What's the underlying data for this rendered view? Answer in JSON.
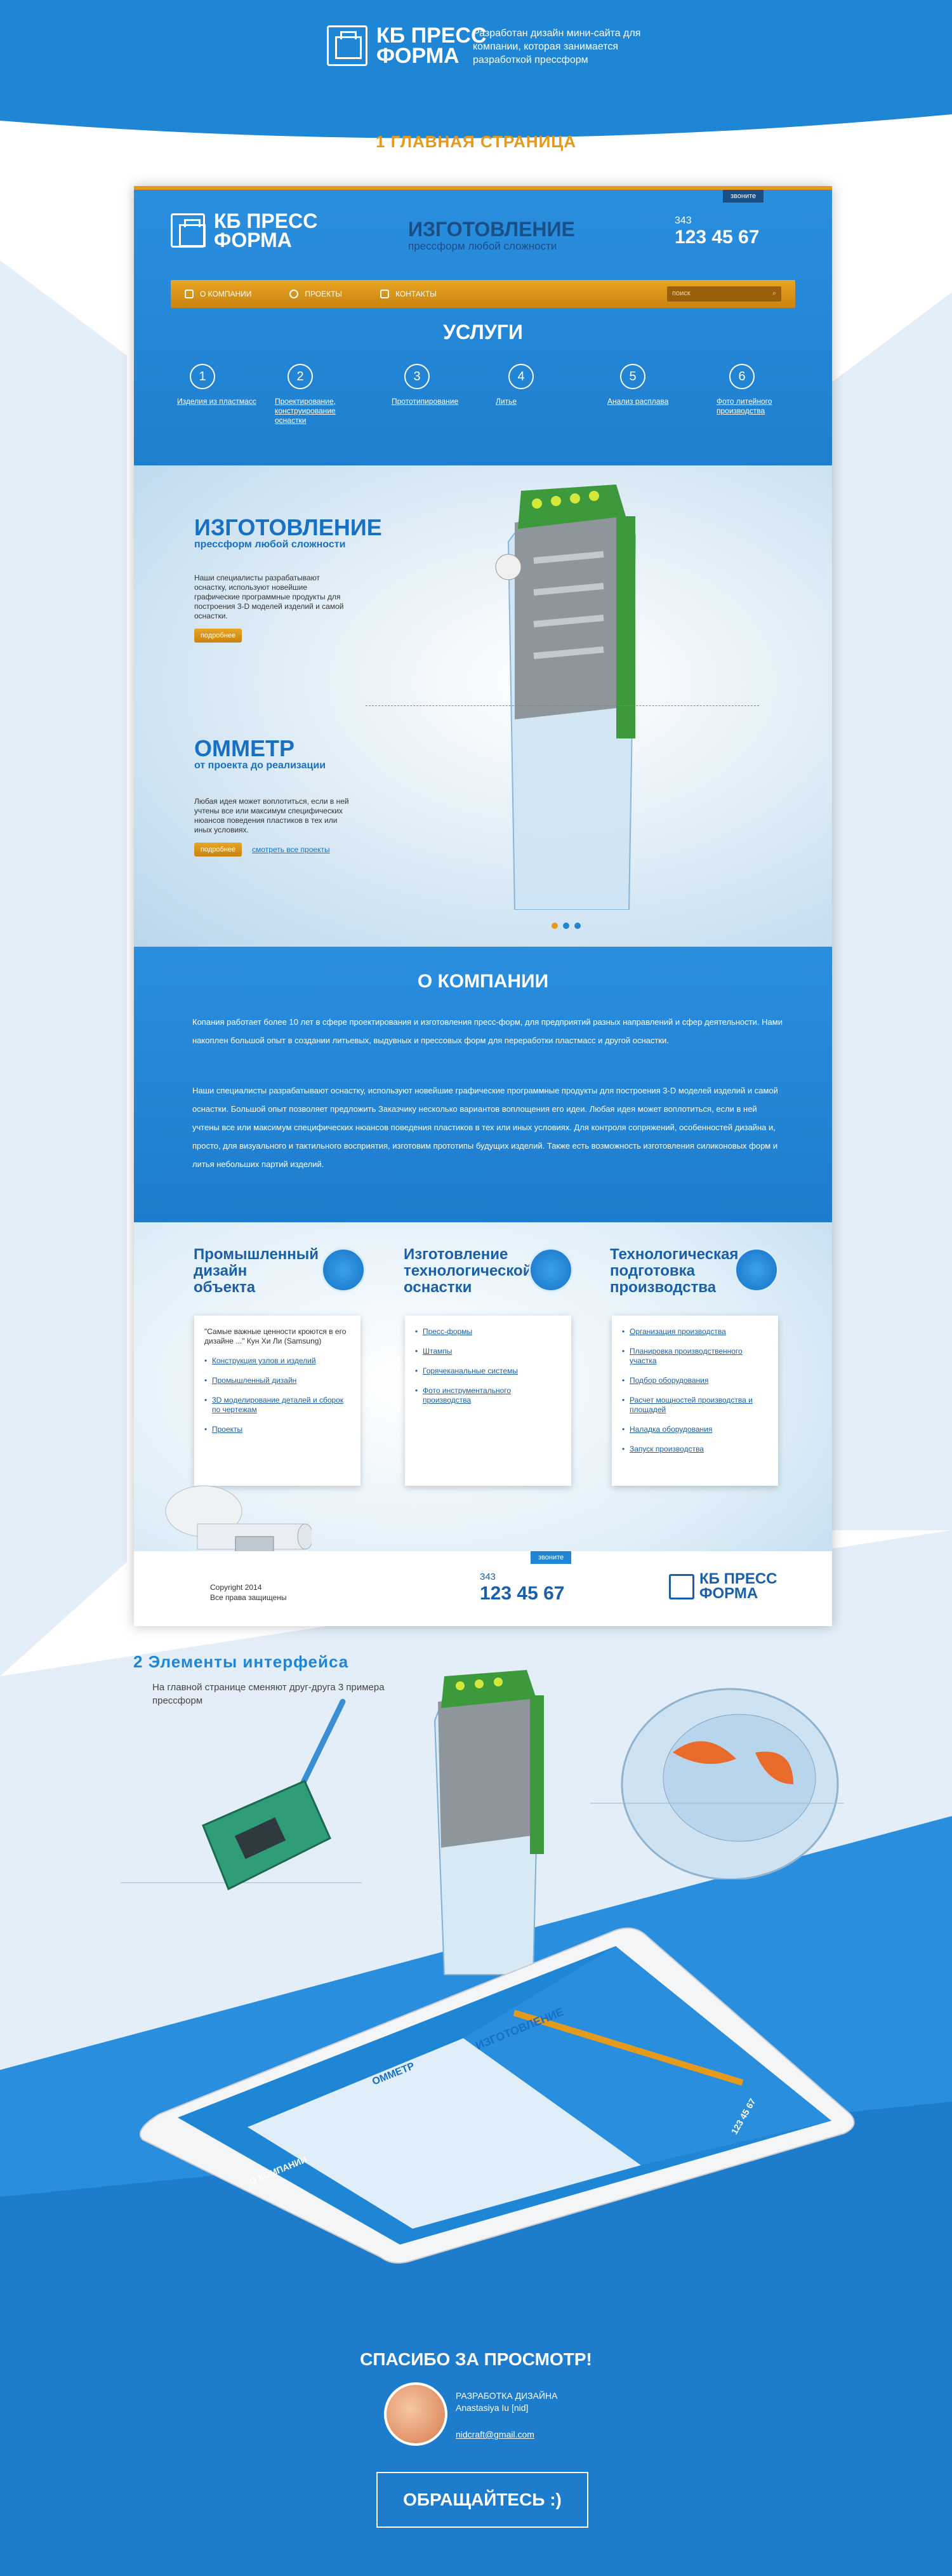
{
  "header": {
    "logo_line1": "КБ ПРЕСС",
    "logo_line2": "ФОРМА",
    "description": "Разработан дизайн мини-сайта для компании, которая занимается разработкой прессформ"
  },
  "section1": {
    "title": "1  ГЛАВНАЯ СТРАНИЦА"
  },
  "site": {
    "top_button": "звоните",
    "logo_line1": "КБ ПРЕСС",
    "logo_line2": "ФОРМА",
    "header_title": "ИЗГОТОВЛЕНИЕ",
    "header_subtitle": "прессформ любой сложности",
    "phone_code": "343",
    "phone": "123 45 67",
    "nav": [
      {
        "label": "О КОМПАНИИ"
      },
      {
        "label": "ПРОЕКТЫ"
      },
      {
        "label": "КОНТАКТЫ"
      }
    ],
    "search_placeholder": "поиск",
    "services_title": "УСЛУГИ",
    "services": [
      {
        "num": "1",
        "label": "Изделия из пластмасс"
      },
      {
        "num": "2",
        "label": "Проектирование, конструирование оснастки"
      },
      {
        "num": "3",
        "label": "Прототипирование"
      },
      {
        "num": "4",
        "label": "Литье"
      },
      {
        "num": "5",
        "label": "Анализ расплава"
      },
      {
        "num": "6",
        "label": "Фото литейного производства"
      }
    ],
    "hero": {
      "title1": "ИЗГОТОВЛЕНИЕ",
      "sub1": "прессформ любой сложности",
      "text1": "Наши специалисты разрабатывают оснастку, используют новейшие графические программные продукты для построения 3-D моделей изделий и самой оснастки.",
      "btn1": "подробнее",
      "title2": "ОММЕТР",
      "sub2": "от проекта до реализации",
      "text2": "Любая идея может воплотиться, если в ней учтены все или максимум специфических нюансов поведения пластиков в тех или иных условиях.",
      "btn2": "подробнее",
      "link2": "смотреть все проекты"
    },
    "about": {
      "title": "О КОМПАНИИ",
      "p1": "Копания работает более 10 лет в сфере проектирования и изготовления пресс-форм, для предприятий разных направлений и сфер деятельности. Нами накоплен большой опыт в создании литьевых, выдувных и прессовых форм для переработки пластмасс и другой оснастки.",
      "p2": "Наши специалисты разрабатывают оснастку, используют новейшие графические программные продукты для построения 3-D моделей изделий и самой оснастки. Большой опыт позволяет предложить Заказчику несколько вариантов воплощения его идеи. Любая идея может воплотиться, если в ней учтены все или максимум специфических нюансов поведения пластиков в тех или иных условиях. Для контроля сопряжений, особенностей дизайна и, просто, для визуального и тактильного восприятия, изготовим прототипы будущих изделий. Также есть возможность изготовления силиконовых форм и литья небольших партий изделий."
    },
    "columns": [
      {
        "title": "Промышленный дизайн объекта",
        "quote": "\"Самые важные ценности кроются в его дизайне ...\" Кун Хи Ли (Samsung)",
        "items": [
          "Конструкция узлов и изделий",
          "Промышленный дизайн",
          "3D моделирование деталей и сборок по чертежам",
          "Проекты"
        ]
      },
      {
        "title": "Изготовление технологической оснастки",
        "items": [
          "Пресс-формы",
          "Штампы",
          "Горячеканальные системы",
          "Фото инструментального производства"
        ]
      },
      {
        "title": "Технологическая подготовка производства",
        "items": [
          "Организация производства",
          "Планировка производственного участка",
          "Подбор оборудования",
          "Расчет мощностей производства и площадей",
          "Наладка оборудования",
          "Запуск производства"
        ]
      }
    ],
    "footer": {
      "copyright": "Copyright 2014",
      "rights": "Все права защищены",
      "button": "звоните",
      "phone_code": "343",
      "phone": "123 45 67",
      "logo_line1": "КБ ПРЕСС",
      "logo_line2": "ФОРМА"
    }
  },
  "section2": {
    "title": "2  Элементы интерфейса",
    "note": "На главной странице сменяют друг-друга 3 примера прессформ"
  },
  "tablet": {
    "title1": "ИЗГОТОВЛЕНИЕ",
    "title2": "ОММЕТР",
    "about": "О КОМПАНИИ",
    "phone": "123 45 67"
  },
  "outro": {
    "thanks": "СПАСИБО ЗА ПРОСМОТР!",
    "role": "РАЗРАБОТКА ДИЗАЙНА",
    "name": "Anastasiya Iu [nid]",
    "email": "nidcraft@gmail.com",
    "contact_button": "ОБРАЩАЙТЕСЬ :)"
  },
  "colors": {
    "blue": "#1f86d6",
    "orange": "#e59a1b",
    "dark_blue": "#1870c4"
  }
}
